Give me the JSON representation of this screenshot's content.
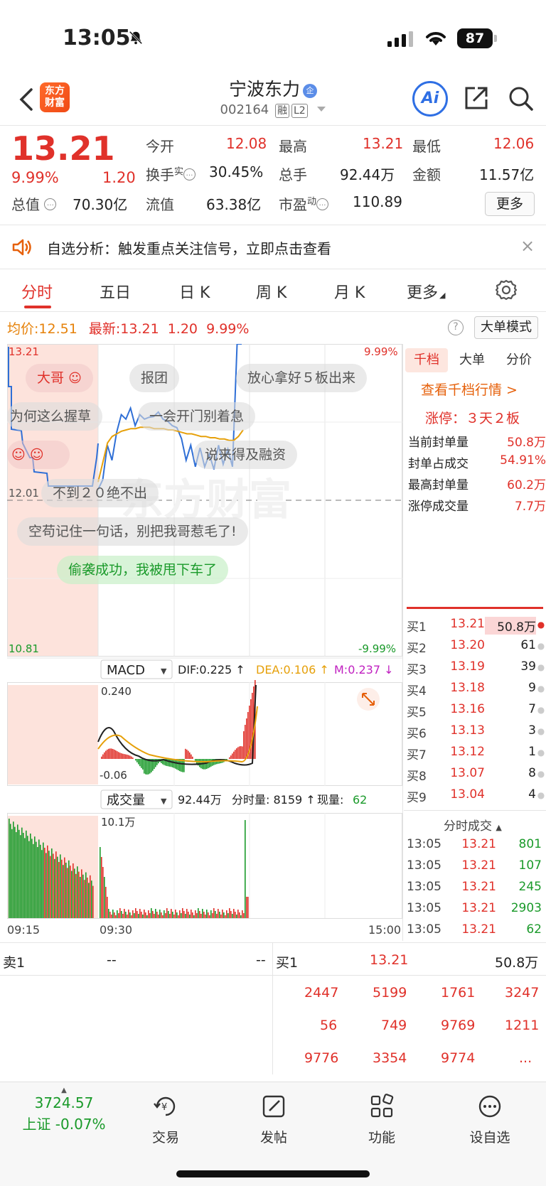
{
  "status": {
    "time": "13:05",
    "battery": "87"
  },
  "header": {
    "logo_line1": "东方",
    "logo_line2": "财富",
    "stock_name": "宁波东力",
    "stock_badge": "企",
    "code": "002164",
    "tag1": "融",
    "tag2": "L2",
    "ai_label": "Ai"
  },
  "quote": {
    "price": "13.21",
    "pct": "9.99%",
    "change": "1.20",
    "open_label": "今开",
    "open": "12.08",
    "high_label": "最高",
    "high": "13.21",
    "low_label": "最低",
    "low": "12.06",
    "turnover_label": "换手",
    "turnover_sup": "实",
    "turnover": "30.45%",
    "volume_label": "总手",
    "volume": "92.44万",
    "amount_label": "金额",
    "amount": "11.57亿",
    "mktcap_label": "总值",
    "mktcap": "70.30亿",
    "float_label": "流值",
    "float": "63.38亿",
    "pe_label": "市盈",
    "pe_sup": "动",
    "pe": "110.89",
    "more_label": "更多"
  },
  "alert": {
    "text": "自选分析：触发重点关注信号，立即点击查看",
    "close": "×"
  },
  "tabs": [
    "分时",
    "五日",
    "日 K",
    "周 K",
    "月 K",
    "更多"
  ],
  "avgline": {
    "avg_label": "均价:",
    "avg": "12.51",
    "last_label": "最新:",
    "last": "13.21",
    "chg": "1.20",
    "pct": "9.99%",
    "help": "?",
    "bigorder_label": "大单模式"
  },
  "chart": {
    "ymax": "13.21",
    "ymax_pct": "9.99%",
    "ymin": "10.81",
    "ymin_pct": "-9.99%",
    "mid": "12.01",
    "macd_label": "MACD",
    "dif": "DIF:0.225 ↑",
    "dea": "DEA:0.106 ↑",
    "m": "M:0.237 ↓",
    "macd_top": "0.240",
    "macd_bot": "-0.06",
    "vol_label": "成交量",
    "vol_total": "92.44万",
    "vol_min": "分时量: 8159 ↑",
    "vol_now_label": "现量:",
    "vol_now": "62",
    "vol_top": "10.1万",
    "t_start": "09:15",
    "t_mid": "09:30",
    "t_end": "15:00",
    "watermark": "东方财富",
    "price_line": [
      12.06,
      12.2,
      12.4,
      12.35,
      12.5,
      12.7,
      12.6,
      12.75,
      12.55,
      12.7,
      12.6,
      12.68,
      12.62,
      12.72,
      12.6,
      12.65,
      12.55,
      12.6,
      12.45,
      12.35,
      12.4,
      12.3,
      12.38,
      12.3,
      12.33,
      12.28,
      12.4,
      12.32,
      12.37,
      12.3,
      13.21,
      13.21
    ],
    "avg_line": [
      12.15,
      12.3,
      12.45,
      12.5,
      12.52,
      12.54,
      12.55,
      12.56,
      12.56,
      12.57,
      12.57,
      12.57,
      12.56,
      12.56,
      12.56,
      12.55,
      12.55,
      12.54,
      12.53,
      12.52,
      12.52,
      12.51,
      12.5,
      12.5,
      12.49,
      12.49,
      12.48,
      12.48,
      12.47,
      12.47,
      12.5,
      12.55
    ]
  },
  "bubbles": [
    "大哥",
    "报团",
    "放心拿好５板出来",
    "为何这么握草",
    "一会开门别着急",
    "说来得及融资",
    "不到２０绝不出",
    "空苟记住一句话，别把我哥惹毛了!",
    "偷袭成功，我被甩下车了"
  ],
  "book": {
    "tabs": [
      "千档",
      "大单",
      "分价"
    ],
    "qd_link": "查看千档行情 >",
    "zt": "涨停：３天２板",
    "stats": [
      {
        "k": "当前封单量",
        "v": "50.8万"
      },
      {
        "k": "封单占成交",
        "v": "54.91%"
      },
      {
        "k": "最高封单量",
        "v": "60.2万"
      },
      {
        "k": "涨停成交量",
        "v": "7.7万"
      }
    ],
    "bids": [
      {
        "n": "买1",
        "p": "13.21",
        "q": "50.8万"
      },
      {
        "n": "买2",
        "p": "13.20",
        "q": "61"
      },
      {
        "n": "买3",
        "p": "13.19",
        "q": "39"
      },
      {
        "n": "买4",
        "p": "13.18",
        "q": "9"
      },
      {
        "n": "买5",
        "p": "13.16",
        "q": "7"
      },
      {
        "n": "买6",
        "p": "13.13",
        "q": "3"
      },
      {
        "n": "买7",
        "p": "13.12",
        "q": "1"
      },
      {
        "n": "买8",
        "p": "13.07",
        "q": "8"
      },
      {
        "n": "买9",
        "p": "13.04",
        "q": "4"
      }
    ],
    "tick_title": "分时成交",
    "ticks": [
      {
        "t": "13:05",
        "p": "13.21",
        "q": "801"
      },
      {
        "t": "13:05",
        "p": "13.21",
        "q": "107"
      },
      {
        "t": "13:05",
        "p": "13.21",
        "q": "245"
      },
      {
        "t": "13:05",
        "p": "13.21",
        "q": "2903"
      },
      {
        "t": "13:05",
        "p": "13.21",
        "q": "62"
      }
    ]
  },
  "panel": {
    "sell1_label": "卖1",
    "sell1_p": "--",
    "sell1_q": "--",
    "buy1_label": "买1",
    "buy1_p": "13.21",
    "buy1_q": "50.8万",
    "rows": [
      [
        "2447",
        "5199",
        "1761",
        "3247"
      ],
      [
        "56",
        "749",
        "9769",
        "1211"
      ],
      [
        "9776",
        "3354",
        "9774",
        "..."
      ]
    ]
  },
  "nav": {
    "index_value": "3724.57",
    "index_label": "上证 -0.07%",
    "items": [
      "交易",
      "发帖",
      "功能",
      "设自选"
    ]
  }
}
